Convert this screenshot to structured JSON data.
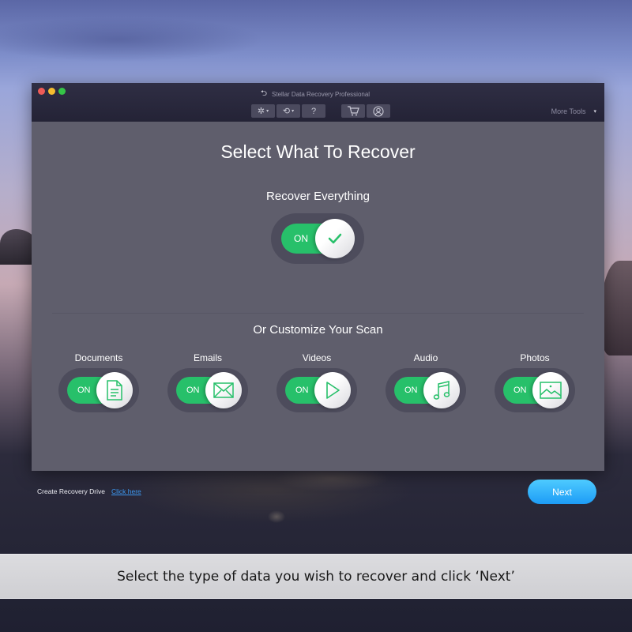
{
  "window": {
    "title": "Stellar Data Recovery Professional",
    "traffic_lights": [
      "close",
      "minimize",
      "maximize"
    ]
  },
  "toolbar": {
    "buttons": [
      {
        "name": "settings",
        "icon": "gear-icon",
        "glyph": "✲",
        "has_dropdown": true
      },
      {
        "name": "history",
        "icon": "history-icon",
        "glyph": "⟲",
        "has_dropdown": true
      },
      {
        "name": "help",
        "icon": "help-icon",
        "glyph": "?",
        "has_dropdown": false
      },
      {
        "name": "cart",
        "icon": "cart-icon",
        "glyph": "🛒",
        "has_dropdown": false
      },
      {
        "name": "account",
        "icon": "user-icon",
        "glyph": "◯",
        "has_dropdown": false
      }
    ],
    "dropdown_caret": "▾",
    "more_tools_label": "More Tools",
    "more_tools_caret": "▾"
  },
  "main": {
    "title": "Select What To Recover",
    "recover_everything": {
      "label": "Recover Everything",
      "state_label": "ON",
      "enabled": true,
      "icon": "check-icon"
    },
    "customize_label": "Or Customize Your Scan",
    "categories": [
      {
        "label": "Documents",
        "state_label": "ON",
        "enabled": true,
        "icon": "document-icon"
      },
      {
        "label": "Emails",
        "state_label": "ON",
        "enabled": true,
        "icon": "envelope-icon"
      },
      {
        "label": "Videos",
        "state_label": "ON",
        "enabled": true,
        "icon": "play-icon"
      },
      {
        "label": "Audio",
        "state_label": "ON",
        "enabled": true,
        "icon": "music-note-icon"
      },
      {
        "label": "Photos",
        "state_label": "ON",
        "enabled": true,
        "icon": "image-icon"
      }
    ]
  },
  "footer": {
    "recovery_drive_label": "Create Recovery Drive",
    "recovery_drive_link": "Click here",
    "next_label": "Next"
  },
  "caption": "Select the type of data you wish to recover and click ‘Next’",
  "colors": {
    "toggle_on": "#27c06a",
    "next_button": "#1d9cf6",
    "link": "#3c98f0",
    "window_bg": "#5f5e6c",
    "titlebar_bg": "#242336"
  }
}
